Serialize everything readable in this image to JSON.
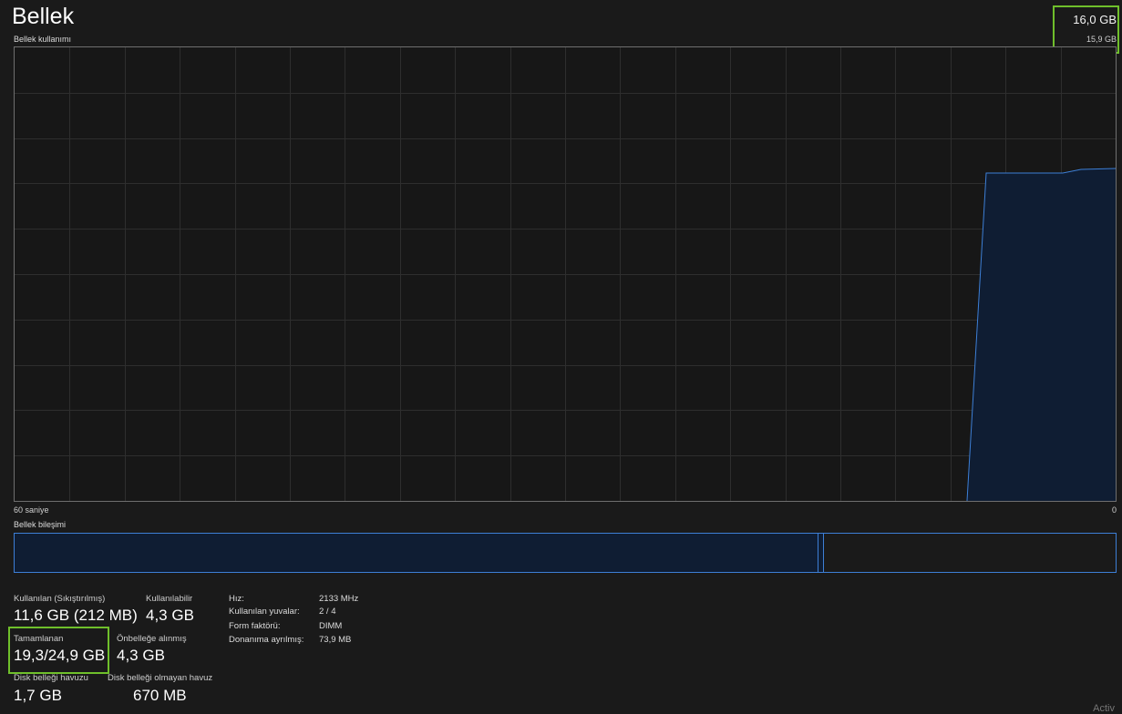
{
  "header": {
    "title": "Bellek",
    "subtitle": "Bellek kullanımı",
    "max_value": "16,0 GB",
    "max_sub_value": "15,9 GB"
  },
  "graph": {
    "time_left": "60 saniye",
    "time_right": "0",
    "line_color": "#3d7fd6",
    "fill_color": "#0f1d33",
    "grid_color": "#2e2e2e"
  },
  "composition": {
    "label": "Bellek bileşimi"
  },
  "stats": {
    "in_use_label": "Kullanılan (Sıkıştırılmış)",
    "in_use_value": "11,6 GB (212 MB)",
    "available_label": "Kullanılabilir",
    "available_value": "4,3 GB",
    "committed_label": "Tamamlanan",
    "committed_value": "19,3/24,9 GB",
    "cached_label": "Önbelleğe alınmış",
    "cached_value": "4,3 GB",
    "paged_label": "Disk belleği havuzu",
    "paged_value": "1,7 GB",
    "nonpaged_label": "Disk belleği olmayan havuz",
    "nonpaged_value": "670 MB"
  },
  "specs": {
    "speed_label": "Hız:",
    "speed_value": "2133 MHz",
    "slots_label": "Kullanılan yuvalar:",
    "slots_value": "2 / 4",
    "form_label": "Form faktörü:",
    "form_value": "DIMM",
    "reserved_label": "Donanıma ayrılmış:",
    "reserved_value": "73,9 MB"
  },
  "watermark": "Activ"
}
